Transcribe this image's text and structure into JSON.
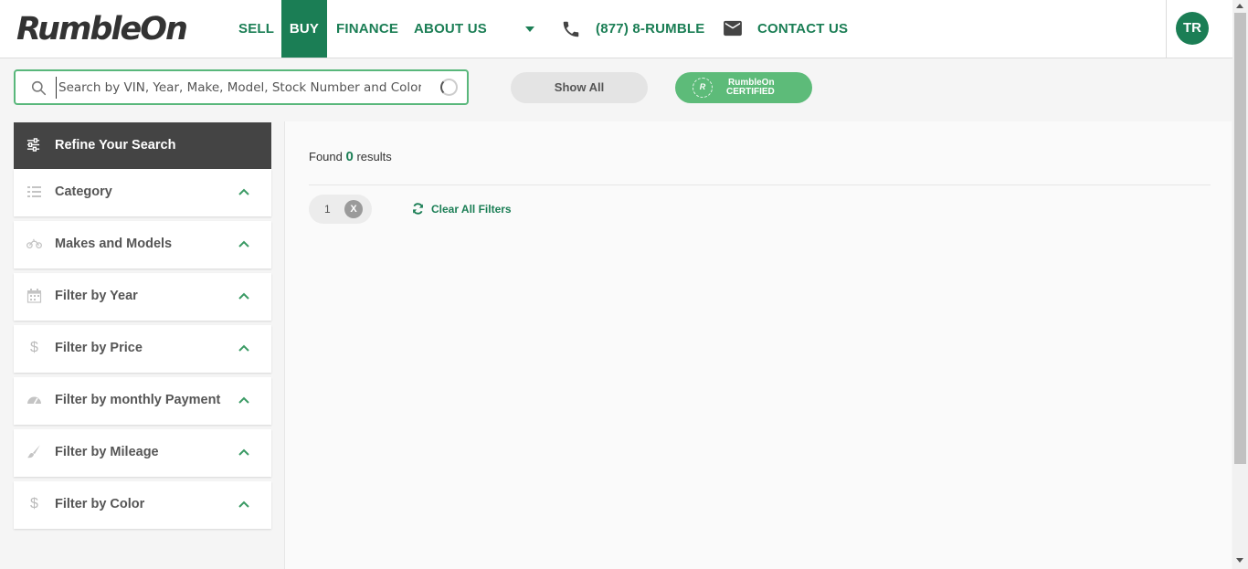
{
  "header": {
    "logo": "RumbleOn",
    "nav": [
      {
        "label": "SELL",
        "active": false
      },
      {
        "label": "BUY",
        "active": true
      },
      {
        "label": "FINANCE",
        "active": false
      },
      {
        "label": "ABOUT US",
        "active": false
      }
    ],
    "phone": "(877) 8-RUMBLE",
    "contact": "CONTACT US",
    "avatar_initials": "TR",
    "icons": [
      "caret-down-icon",
      "phone-icon",
      "mail-icon"
    ]
  },
  "search": {
    "placeholder": "Search by VIN, Year, Make, Model, Stock Number and Color",
    "value": "",
    "show_all_label": "Show All",
    "certified_line1": "RumbleOn",
    "certified_line2": "CERTIFIED",
    "certified_badge": "R"
  },
  "sidebar": {
    "title": "Refine Your Search",
    "filters": [
      {
        "label": "Category",
        "icon": "list-icon"
      },
      {
        "label": "Makes and Models",
        "icon": "motorcycle-icon"
      },
      {
        "label": "Filter by Year",
        "icon": "calendar-icon"
      },
      {
        "label": "Filter by Price",
        "icon": "dollar-icon"
      },
      {
        "label": "Filter by monthly Payment",
        "icon": "speedometer-icon"
      },
      {
        "label": "Filter by Mileage",
        "icon": "brush-icon"
      },
      {
        "label": "Filter by Color",
        "icon": "dollar-icon"
      }
    ]
  },
  "results": {
    "found_prefix": "Found",
    "count": "0",
    "found_suffix": "results",
    "chip_label": "1",
    "chip_remove": "X",
    "clear_all": "Clear All Filters"
  },
  "colors": {
    "brand_green": "#1b7e55",
    "accent_green": "#5dbb79",
    "sidebar_header": "#444444"
  }
}
